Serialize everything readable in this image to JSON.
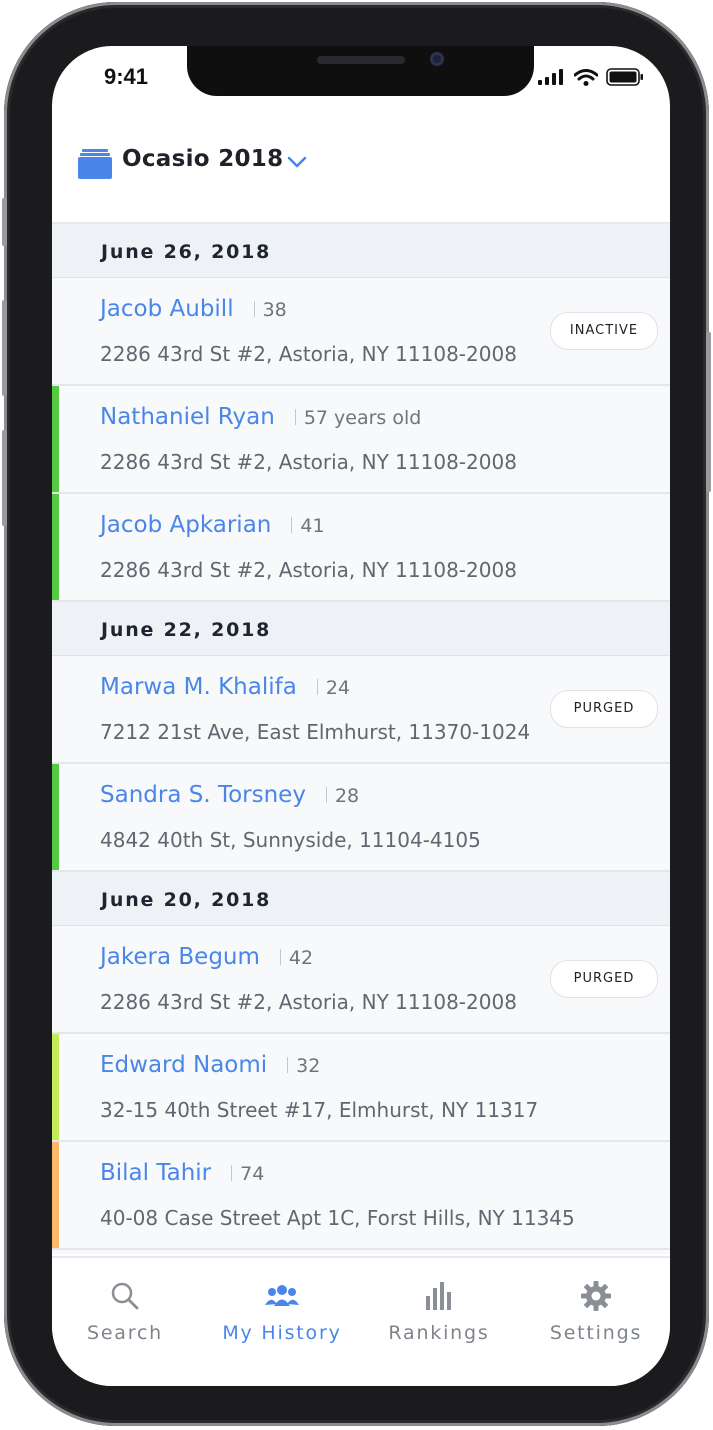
{
  "status_bar": {
    "time": "9:41"
  },
  "header": {
    "project_title": "Ocasio 2018"
  },
  "sections": [
    {
      "date": "June 26, 2018",
      "people": [
        {
          "name": "Jacob Aubill",
          "age": "38",
          "address": "2286 43rd St #2, Astoria, NY 11108-2008",
          "badge": "INACTIVE",
          "stripe_color": ""
        },
        {
          "name": "Nathaniel Ryan",
          "age": "57 years old",
          "address": "2286 43rd St #2, Astoria, NY 11108-2008",
          "badge": "",
          "stripe_color": "#54c942"
        },
        {
          "name": "Jacob Apkarian",
          "age": "41",
          "address": "2286 43rd St #2, Astoria, NY 11108-2008",
          "badge": "",
          "stripe_color": "#54c942"
        }
      ]
    },
    {
      "date": "June 22, 2018",
      "people": [
        {
          "name": "Marwa M. Khalifa",
          "age": "24",
          "address": "7212 21st Ave, East Elmhurst, 11370-1024",
          "badge": "PURGED",
          "stripe_color": ""
        },
        {
          "name": "Sandra S. Torsney",
          "age": "28",
          "address": "4842 40th St, Sunnyside, 11104-4105",
          "badge": "",
          "stripe_color": "#54c942"
        }
      ]
    },
    {
      "date": "June 20, 2018",
      "people": [
        {
          "name": "Jakera Begum",
          "age": "42",
          "address": "2286 43rd St #2, Astoria, NY 11108-2008",
          "badge": "PURGED",
          "stripe_color": ""
        },
        {
          "name": "Edward Naomi",
          "age": "32",
          "address": "32-15 40th Street #17, Elmhurst, NY 11317",
          "badge": "",
          "stripe_color": "#c4ec56"
        },
        {
          "name": "Bilal Tahir",
          "age": "74",
          "address": "40-08 Case Street Apt 1C, Forst Hills, NY 11345",
          "badge": "",
          "stripe_color": "#fbb86a"
        }
      ]
    }
  ],
  "tabs": [
    {
      "label": "Search",
      "icon": "search-icon",
      "active": false
    },
    {
      "label": "My History",
      "icon": "people-icon",
      "active": true
    },
    {
      "label": "Rankings",
      "icon": "bar-chart-icon",
      "active": false
    },
    {
      "label": "Settings",
      "icon": "gear-icon",
      "active": false
    }
  ],
  "colors": {
    "accent": "#4a86e8",
    "active_green": "#54c942",
    "lime": "#c4ec56",
    "orange": "#fbb86a"
  }
}
